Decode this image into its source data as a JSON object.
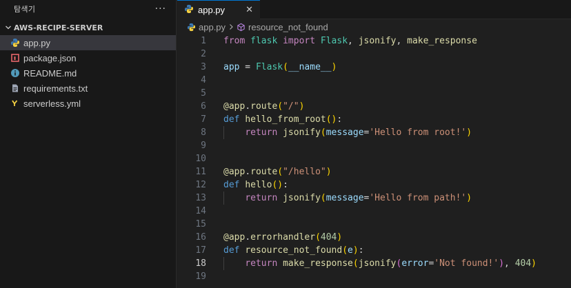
{
  "explorer": {
    "title": "탐색기",
    "more": "···",
    "folder": "AWS-RECIPE-SERVER",
    "files": [
      {
        "name": "app.py",
        "icon": "python",
        "active": true
      },
      {
        "name": "package.json",
        "icon": "npm",
        "active": false
      },
      {
        "name": "README.md",
        "icon": "info",
        "active": false
      },
      {
        "name": "requirements.txt",
        "icon": "text",
        "active": false
      },
      {
        "name": "serverless.yml",
        "icon": "yaml",
        "active": false
      }
    ]
  },
  "tabs": [
    {
      "label": "app.py",
      "close": "✕"
    }
  ],
  "breadcrumb": {
    "file": "app.py",
    "symbol": "resource_not_found"
  },
  "current_line": 18,
  "colors": {
    "accent": "#0078d4",
    "keyword": "#569cd6",
    "control": "#c586c0",
    "function": "#dcdcaa",
    "class": "#4ec9b0",
    "variable": "#9cdcfe",
    "string": "#ce9178",
    "number": "#b5cea8"
  },
  "code_lines": [
    {
      "n": "1",
      "tokens": [
        [
          "kw2",
          "from"
        ],
        [
          "pl",
          " "
        ],
        [
          "cls",
          "flask"
        ],
        [
          "pl",
          " "
        ],
        [
          "kw2",
          "import"
        ],
        [
          "pl",
          " "
        ],
        [
          "cls",
          "Flask"
        ],
        [
          "pl",
          ", "
        ],
        [
          "fn",
          "jsonify"
        ],
        [
          "pl",
          ", "
        ],
        [
          "fn",
          "make_response"
        ]
      ]
    },
    {
      "n": "2",
      "tokens": []
    },
    {
      "n": "3",
      "tokens": [
        [
          "var",
          "app"
        ],
        [
          "pl",
          " = "
        ],
        [
          "cls",
          "Flask"
        ],
        [
          "br1",
          "("
        ],
        [
          "var",
          "__name__"
        ],
        [
          "br1",
          ")"
        ]
      ]
    },
    {
      "n": "4",
      "tokens": []
    },
    {
      "n": "5",
      "tokens": []
    },
    {
      "n": "6",
      "tokens": [
        [
          "fn",
          "@"
        ],
        [
          "fn",
          "app"
        ],
        [
          "pl",
          "."
        ],
        [
          "fn",
          "route"
        ],
        [
          "br1",
          "("
        ],
        [
          "str",
          "\"/\""
        ],
        [
          "br1",
          ")"
        ]
      ]
    },
    {
      "n": "7",
      "tokens": [
        [
          "kw",
          "def"
        ],
        [
          "pl",
          " "
        ],
        [
          "fn",
          "hello_from_root"
        ],
        [
          "br1",
          "()"
        ],
        [
          "pl",
          ":"
        ]
      ]
    },
    {
      "n": "8",
      "guide": true,
      "tokens": [
        [
          "pl",
          "    "
        ],
        [
          "kw2",
          "return"
        ],
        [
          "pl",
          " "
        ],
        [
          "fn",
          "jsonify"
        ],
        [
          "br1",
          "("
        ],
        [
          "var",
          "message"
        ],
        [
          "pl",
          "="
        ],
        [
          "str",
          "'Hello from root!'"
        ],
        [
          "br1",
          ")"
        ]
      ]
    },
    {
      "n": "9",
      "tokens": []
    },
    {
      "n": "10",
      "tokens": []
    },
    {
      "n": "11",
      "tokens": [
        [
          "fn",
          "@"
        ],
        [
          "fn",
          "app"
        ],
        [
          "pl",
          "."
        ],
        [
          "fn",
          "route"
        ],
        [
          "br1",
          "("
        ],
        [
          "str",
          "\"/hello\""
        ],
        [
          "br1",
          ")"
        ]
      ]
    },
    {
      "n": "12",
      "tokens": [
        [
          "kw",
          "def"
        ],
        [
          "pl",
          " "
        ],
        [
          "fn",
          "hello"
        ],
        [
          "br1",
          "()"
        ],
        [
          "pl",
          ":"
        ]
      ]
    },
    {
      "n": "13",
      "guide": true,
      "tokens": [
        [
          "pl",
          "    "
        ],
        [
          "kw2",
          "return"
        ],
        [
          "pl",
          " "
        ],
        [
          "fn",
          "jsonify"
        ],
        [
          "br1",
          "("
        ],
        [
          "var",
          "message"
        ],
        [
          "pl",
          "="
        ],
        [
          "str",
          "'Hello from path!'"
        ],
        [
          "br1",
          ")"
        ]
      ]
    },
    {
      "n": "14",
      "tokens": []
    },
    {
      "n": "15",
      "tokens": []
    },
    {
      "n": "16",
      "tokens": [
        [
          "fn",
          "@"
        ],
        [
          "fn",
          "app"
        ],
        [
          "pl",
          "."
        ],
        [
          "fn",
          "errorhandler"
        ],
        [
          "br1",
          "("
        ],
        [
          "num",
          "404"
        ],
        [
          "br1",
          ")"
        ]
      ]
    },
    {
      "n": "17",
      "tokens": [
        [
          "kw",
          "def"
        ],
        [
          "pl",
          " "
        ],
        [
          "fn",
          "resource_not_found"
        ],
        [
          "br1",
          "("
        ],
        [
          "var",
          "e"
        ],
        [
          "br1",
          ")"
        ],
        [
          "pl",
          ":"
        ]
      ]
    },
    {
      "n": "18",
      "guide": true,
      "tokens": [
        [
          "pl",
          "    "
        ],
        [
          "kw2",
          "return"
        ],
        [
          "pl",
          " "
        ],
        [
          "fn",
          "make_response"
        ],
        [
          "br1",
          "("
        ],
        [
          "fn",
          "jsonify"
        ],
        [
          "br2",
          "("
        ],
        [
          "var",
          "error"
        ],
        [
          "pl",
          "="
        ],
        [
          "str",
          "'Not found!'"
        ],
        [
          "br2",
          ")"
        ],
        [
          "pl",
          ", "
        ],
        [
          "num",
          "404"
        ],
        [
          "br1",
          ")"
        ]
      ]
    },
    {
      "n": "19",
      "tokens": []
    }
  ]
}
